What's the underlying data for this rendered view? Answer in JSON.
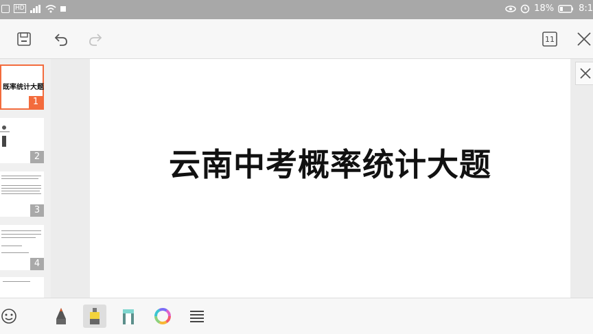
{
  "status_bar": {
    "battery_percent": "18%",
    "time": "8:1",
    "icons": [
      "notification-icon",
      "hd-icon",
      "signal-icon",
      "wifi-icon",
      "eye-icon",
      "alarm-icon",
      "battery-icon"
    ]
  },
  "toolbar": {
    "icons": [
      "save-icon",
      "undo-icon",
      "redo-icon",
      "page-count-icon",
      "close-icon"
    ],
    "page_count": "11"
  },
  "thumbnails": [
    {
      "number": "1",
      "title": "既率统计大题",
      "active": true
    },
    {
      "number": "2",
      "active": false
    },
    {
      "number": "3",
      "active": false
    },
    {
      "number": "4",
      "active": false
    }
  ],
  "slide": {
    "title": "云南中考概率统计大题"
  },
  "bottom_tools": {
    "icons": [
      "sticker-icon",
      "pen-icon",
      "highlighter-icon",
      "eraser-icon",
      "color-wheel-icon",
      "menu-icon"
    ],
    "colors": {
      "accent": "#f36b3c",
      "highlighter": "#f2d33c",
      "eraser": "#7fd6cf"
    }
  }
}
